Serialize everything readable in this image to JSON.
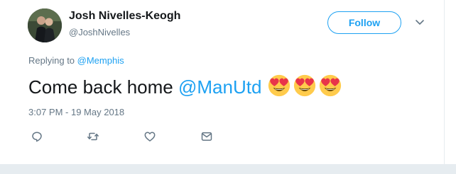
{
  "tweet": {
    "author": {
      "name": "Josh Nivelles-Keogh",
      "handle": "@JoshNivelles"
    },
    "follow_label": "Follow",
    "replying_to_prefix": "Replying to ",
    "replying_to_handle": "@Memphis",
    "text_before": "Come back home ",
    "text_mention": "@ManUtd",
    "emojis": [
      "smiling-face-with-heart-eyes",
      "smiling-face-with-heart-eyes",
      "smiling-face-with-heart-eyes"
    ],
    "timestamp": "3:07 PM - 19 May 2018"
  },
  "actions": [
    "reply-icon",
    "retweet-icon",
    "like-icon",
    "direct-message-icon"
  ],
  "colors": {
    "accent": "#1da1f2",
    "secondary_text": "#657786",
    "primary_text": "#14171a",
    "emoji_face": "#ffcb4c",
    "emoji_heart": "#e8344a"
  }
}
